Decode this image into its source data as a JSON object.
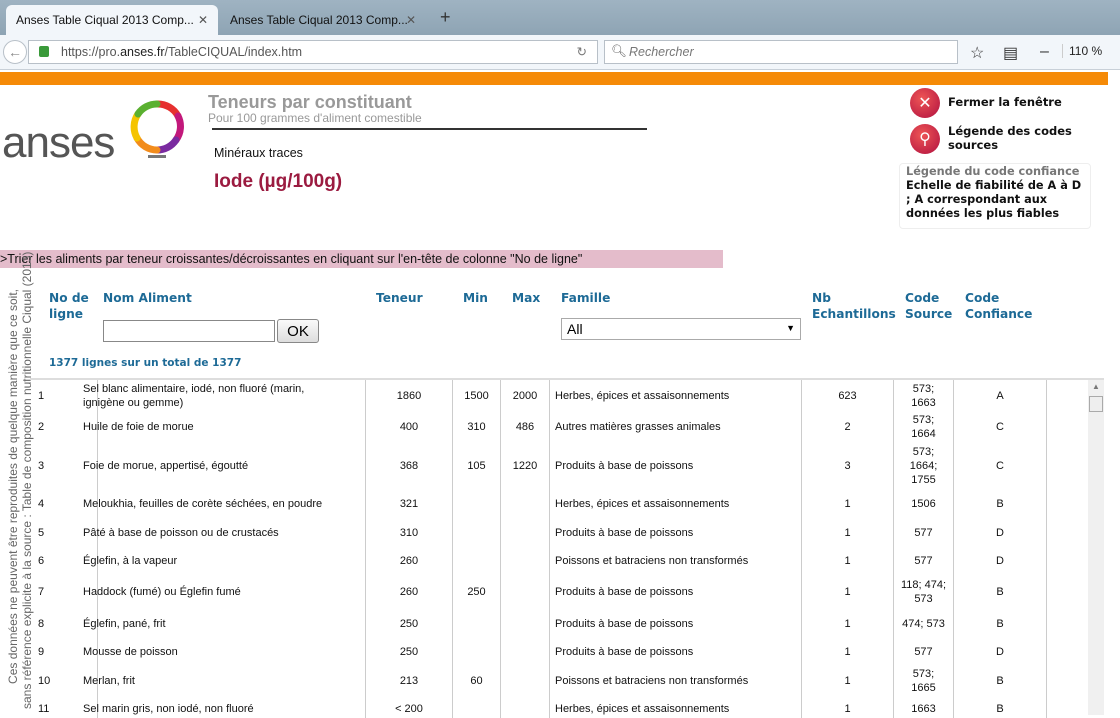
{
  "browser": {
    "tabs": [
      {
        "title": "Anses Table Ciqual 2013 Comp..."
      },
      {
        "title": "Anses Table Ciqual 2013 Comp..."
      }
    ],
    "url_prefix": "https://pro.",
    "url_domain": "anses.fr",
    "url_path": "/TableCIQUAL/index.htm",
    "search_placeholder": "Rechercher",
    "zoom": "110 %"
  },
  "header": {
    "logo": "anses",
    "title": "Teneurs par constituant",
    "subtitle": "Pour 100 grammes d'aliment comestible",
    "category": "Minéraux traces",
    "constituent": "Iode (µg/100g)"
  },
  "links": {
    "close": "Fermer la fenêtre",
    "legend_sources": "Légende des codes sources"
  },
  "legend": {
    "title": "Légende du code confiance",
    "text": "Echelle de fiabilité de A à D ; A correspondant aux données les plus fiables"
  },
  "sort_hint": ">Trier les aliments par teneur croissantes/décroissantes en cliquant sur l'en-tête de colonne \"No de ligne\"",
  "disclaimer": {
    "line1": "Ces données ne peuvent être reproduites de quelque manière que ce soit,",
    "line2": "sans référence explicite à la source : Table de composition nutritionnelle Ciqual (2013)"
  },
  "columns": {
    "no": "No de ligne",
    "nom": "Nom Aliment",
    "teneur": "Teneur",
    "min": "Min",
    "max": "Max",
    "famille": "Famille",
    "nb": "Nb Echantillons",
    "source": "Code Source",
    "confiance": "Code Confiance"
  },
  "filter": {
    "name_value": "",
    "ok": "OK",
    "famille_selected": "All"
  },
  "count": "1377 lignes sur un total de 1377",
  "rows": [
    {
      "no": "1",
      "nom": "Sel blanc alimentaire, iodé, non fluoré (marin, ignigène ou gemme)",
      "teneur": "1860",
      "min": "1500",
      "max": "2000",
      "famille": "Herbes, épices et assaisonnements",
      "nb": "623",
      "source": "573; 1663",
      "conf": "A"
    },
    {
      "no": "2",
      "nom": "Huile de foie de morue",
      "teneur": "400",
      "min": "310",
      "max": "486",
      "famille": "Autres matières grasses animales",
      "nb": "2",
      "source": "573; 1664",
      "conf": "C"
    },
    {
      "no": "3",
      "nom": "Foie de morue, appertisé, égoutté",
      "teneur": "368",
      "min": "105",
      "max": "1220",
      "famille": "Produits à base de poissons",
      "nb": "3",
      "source": "573; 1664; 1755",
      "conf": "C"
    },
    {
      "no": "4",
      "nom": "Meloukhia, feuilles de corète séchées, en poudre",
      "teneur": "321",
      "min": "",
      "max": "",
      "famille": "Herbes, épices et assaisonnements",
      "nb": "1",
      "source": "1506",
      "conf": "B"
    },
    {
      "no": "5",
      "nom": "Pâté à base de poisson ou de crustacés",
      "teneur": "310",
      "min": "",
      "max": "",
      "famille": "Produits à base de poissons",
      "nb": "1",
      "source": "577",
      "conf": "D"
    },
    {
      "no": "6",
      "nom": "Églefin, à la vapeur",
      "teneur": "260",
      "min": "",
      "max": "",
      "famille": "Poissons et batraciens non transformés",
      "nb": "1",
      "source": "577",
      "conf": "D"
    },
    {
      "no": "7",
      "nom": "Haddock (fumé) ou Églefin fumé",
      "teneur": "260",
      "min": "250",
      "max": "",
      "famille": "Produits à base de poissons",
      "nb": "1",
      "source": "118; 474; 573",
      "conf": "B"
    },
    {
      "no": "8",
      "nom": "Églefin, pané, frit",
      "teneur": "250",
      "min": "",
      "max": "",
      "famille": "Produits à base de poissons",
      "nb": "1",
      "source": "474; 573",
      "conf": "B"
    },
    {
      "no": "9",
      "nom": "Mousse de poisson",
      "teneur": "250",
      "min": "",
      "max": "",
      "famille": "Produits à base de poissons",
      "nb": "1",
      "source": "577",
      "conf": "D"
    },
    {
      "no": "10",
      "nom": "Merlan, frit",
      "teneur": "213",
      "min": "60",
      "max": "",
      "famille": "Poissons et batraciens non transformés",
      "nb": "1",
      "source": "573; 1665",
      "conf": "B"
    },
    {
      "no": "11",
      "nom": "Sel marin gris, non iodé, non fluoré",
      "teneur": "< 200",
      "min": "",
      "max": "",
      "famille": "Herbes, épices et assaisonnements",
      "nb": "1",
      "source": "1663",
      "conf": "B"
    }
  ]
}
